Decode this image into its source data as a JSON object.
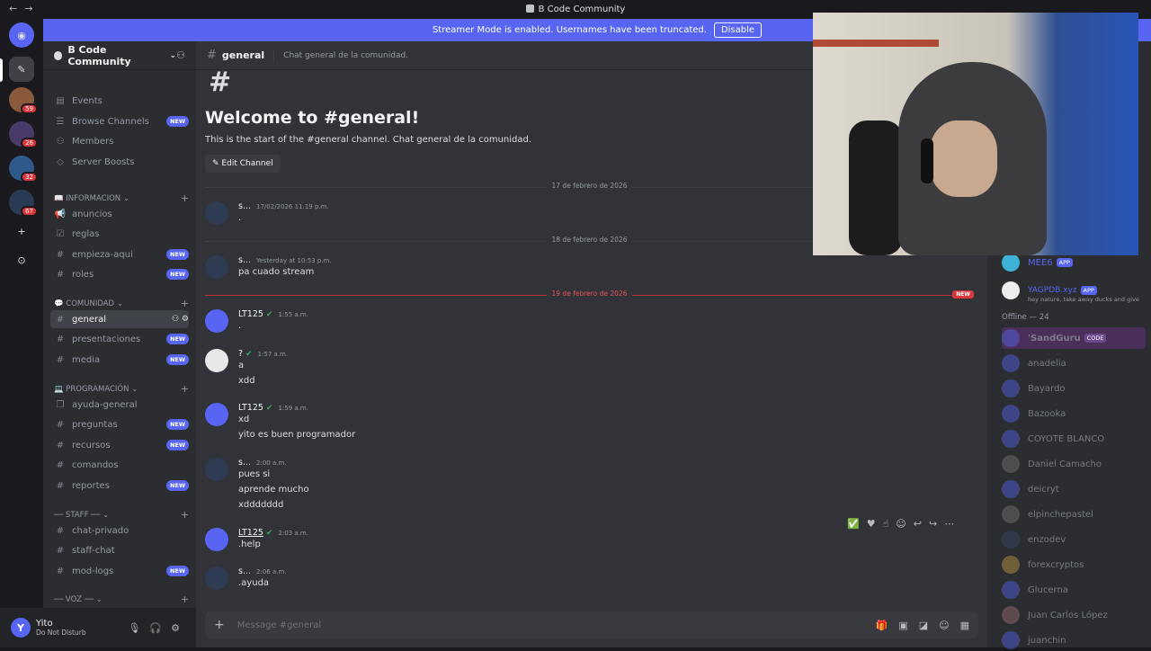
{
  "window": {
    "title": "B Code Community"
  },
  "banner": {
    "text": "Streamer Mode is enabled. Usernames have been truncated.",
    "button": "Disable"
  },
  "guilds": [
    {
      "badge": "59"
    },
    {
      "badge": "26"
    },
    {
      "badge": "32"
    },
    {
      "badge": "67"
    }
  ],
  "server": {
    "name": "B Code Community"
  },
  "sidebar": {
    "top_items": [
      {
        "label": "Events"
      },
      {
        "label": "Browse Channels",
        "badge": "NEW"
      },
      {
        "label": "Members"
      },
      {
        "label": "Server Boosts"
      }
    ],
    "categories": [
      {
        "label": "INFORMACION",
        "emoji": "📖"
      },
      {
        "label": "COMUNIDAD",
        "emoji": "💬"
      },
      {
        "label": "PROGRAMACIÓN",
        "emoji": "💻"
      },
      {
        "label": "── STAFF ──"
      },
      {
        "label": "── VOZ ──"
      }
    ],
    "channels": [
      {
        "label": "anuncios"
      },
      {
        "label": "reglas"
      },
      {
        "label": "empieza-aqui",
        "badge": "NEW"
      },
      {
        "label": "roles",
        "badge": "NEW"
      },
      {
        "label": "general"
      },
      {
        "label": "presentaciones",
        "badge": "NEW"
      },
      {
        "label": "media",
        "badge": "NEW"
      },
      {
        "label": "ayuda-general"
      },
      {
        "label": "preguntas",
        "badge": "NEW"
      },
      {
        "label": "recursos",
        "badge": "NEW"
      },
      {
        "label": "comandos"
      },
      {
        "label": "reportes",
        "badge": "NEW"
      },
      {
        "label": "chat-privado"
      },
      {
        "label": "staff-chat"
      },
      {
        "label": "mod-logs",
        "badge": "NEW"
      }
    ]
  },
  "user": {
    "initial": "Y",
    "name": "Yito",
    "status": "Do Not Disturb"
  },
  "channel": {
    "name": "general",
    "topic": "Chat general de la comunidad.",
    "welcome_title": "Welcome to #general!",
    "welcome_sub": "This is the start of the #general channel. Chat general de la comunidad.",
    "edit_button": "Edit Channel"
  },
  "dividers": [
    "17 de febrero de 2026",
    "18 de febrero de 2026",
    "19 de febrero de 2026"
  ],
  "new_tag": "NEW",
  "messages": [
    {
      "user": "s...",
      "time": "17/02/2026 11:19 p.m.",
      "lines": [
        "."
      ]
    },
    {
      "user": "s...",
      "time": "Yesterday at 10:53 p.m.",
      "lines": [
        "pa cuado stream"
      ]
    },
    {
      "user": "LT125",
      "time": "1:55 a.m.",
      "lines": [
        "."
      ]
    },
    {
      "user": "?",
      "time": "1:57 a.m.",
      "lines": [
        "a",
        "xdd"
      ]
    },
    {
      "user": "LT125",
      "time": "1:59 a.m.",
      "lines": [
        "xd",
        "yito es buen programador"
      ]
    },
    {
      "user": "s...",
      "time": "2:00 a.m.",
      "lines": [
        "pues si",
        "aprende mucho",
        "xddddddd"
      ]
    },
    {
      "user": "LT125",
      "time": "2:03 a.m.",
      "lines": [
        ".help"
      ]
    },
    {
      "user": "s...",
      "time": "2:06 a.m.",
      "lines": [
        ".ayuda"
      ]
    }
  ],
  "composer": {
    "placeholder": "Message #general"
  },
  "members": {
    "bots": [
      {
        "name": "MEE6",
        "tag": "APP"
      },
      {
        "name": "YAGPDB.xyz",
        "tag": "APP",
        "status": "hey nature, take away ducks and give"
      }
    ],
    "offline_header": "Offline — 24",
    "offline": [
      {
        "name": "'SandGuru",
        "tag": "CODE"
      },
      {
        "name": "anadelia"
      },
      {
        "name": "Bayardo"
      },
      {
        "name": "Bazooka"
      },
      {
        "name": "COYOTE BLANCO"
      },
      {
        "name": "Daniel Camacho"
      },
      {
        "name": "deicryt"
      },
      {
        "name": "elpinchepastel"
      },
      {
        "name": "enzodev"
      },
      {
        "name": "forexcryptos"
      },
      {
        "name": "Glucerna"
      },
      {
        "name": "Juan Carlos López"
      },
      {
        "name": "juanchin"
      }
    ]
  },
  "colors": {
    "accent": "#5865f2",
    "dnd": "#da373c",
    "verified": "#3ba55c"
  }
}
